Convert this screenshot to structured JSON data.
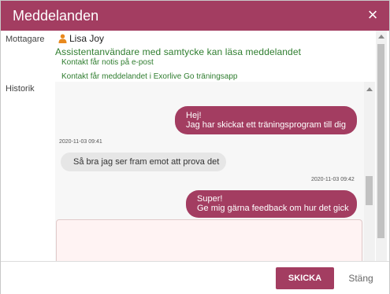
{
  "dialog": {
    "title": "Meddelanden",
    "close_icon": "×"
  },
  "recipient": {
    "label": "Mottagare",
    "name": "Lisa Joy",
    "icon": "person-icon",
    "consent_text": "Assistentanvändare med samtycke kan läsa meddelandet",
    "notify_email": "Kontakt får notis på e-post",
    "notify_app": "Kontakt får meddelandet i Exorlive Go träningsapp"
  },
  "history": {
    "label": "Historik",
    "messages": [
      {
        "direction": "sent",
        "lines": [
          "Hej!",
          "Jag har skickat ett träningsprogram till dig"
        ]
      },
      {
        "timestamp": "2020-11-03 09:41"
      },
      {
        "direction": "received",
        "lines": [
          "Så bra jag ser fram emot att prova det"
        ]
      },
      {
        "timestamp": "2020-11-03 09:42"
      },
      {
        "direction": "sent",
        "lines": [
          "Super!",
          "Ge mig gärna feedback om hur det gick"
        ]
      }
    ]
  },
  "compose": {
    "value": "",
    "placeholder": ""
  },
  "footer": {
    "send_label": "SKICKA",
    "close_label": "Stäng"
  },
  "colors": {
    "brand": "#a33d61",
    "consent_green": "#2f7d2f",
    "received_bubble": "#e6e6e6"
  }
}
